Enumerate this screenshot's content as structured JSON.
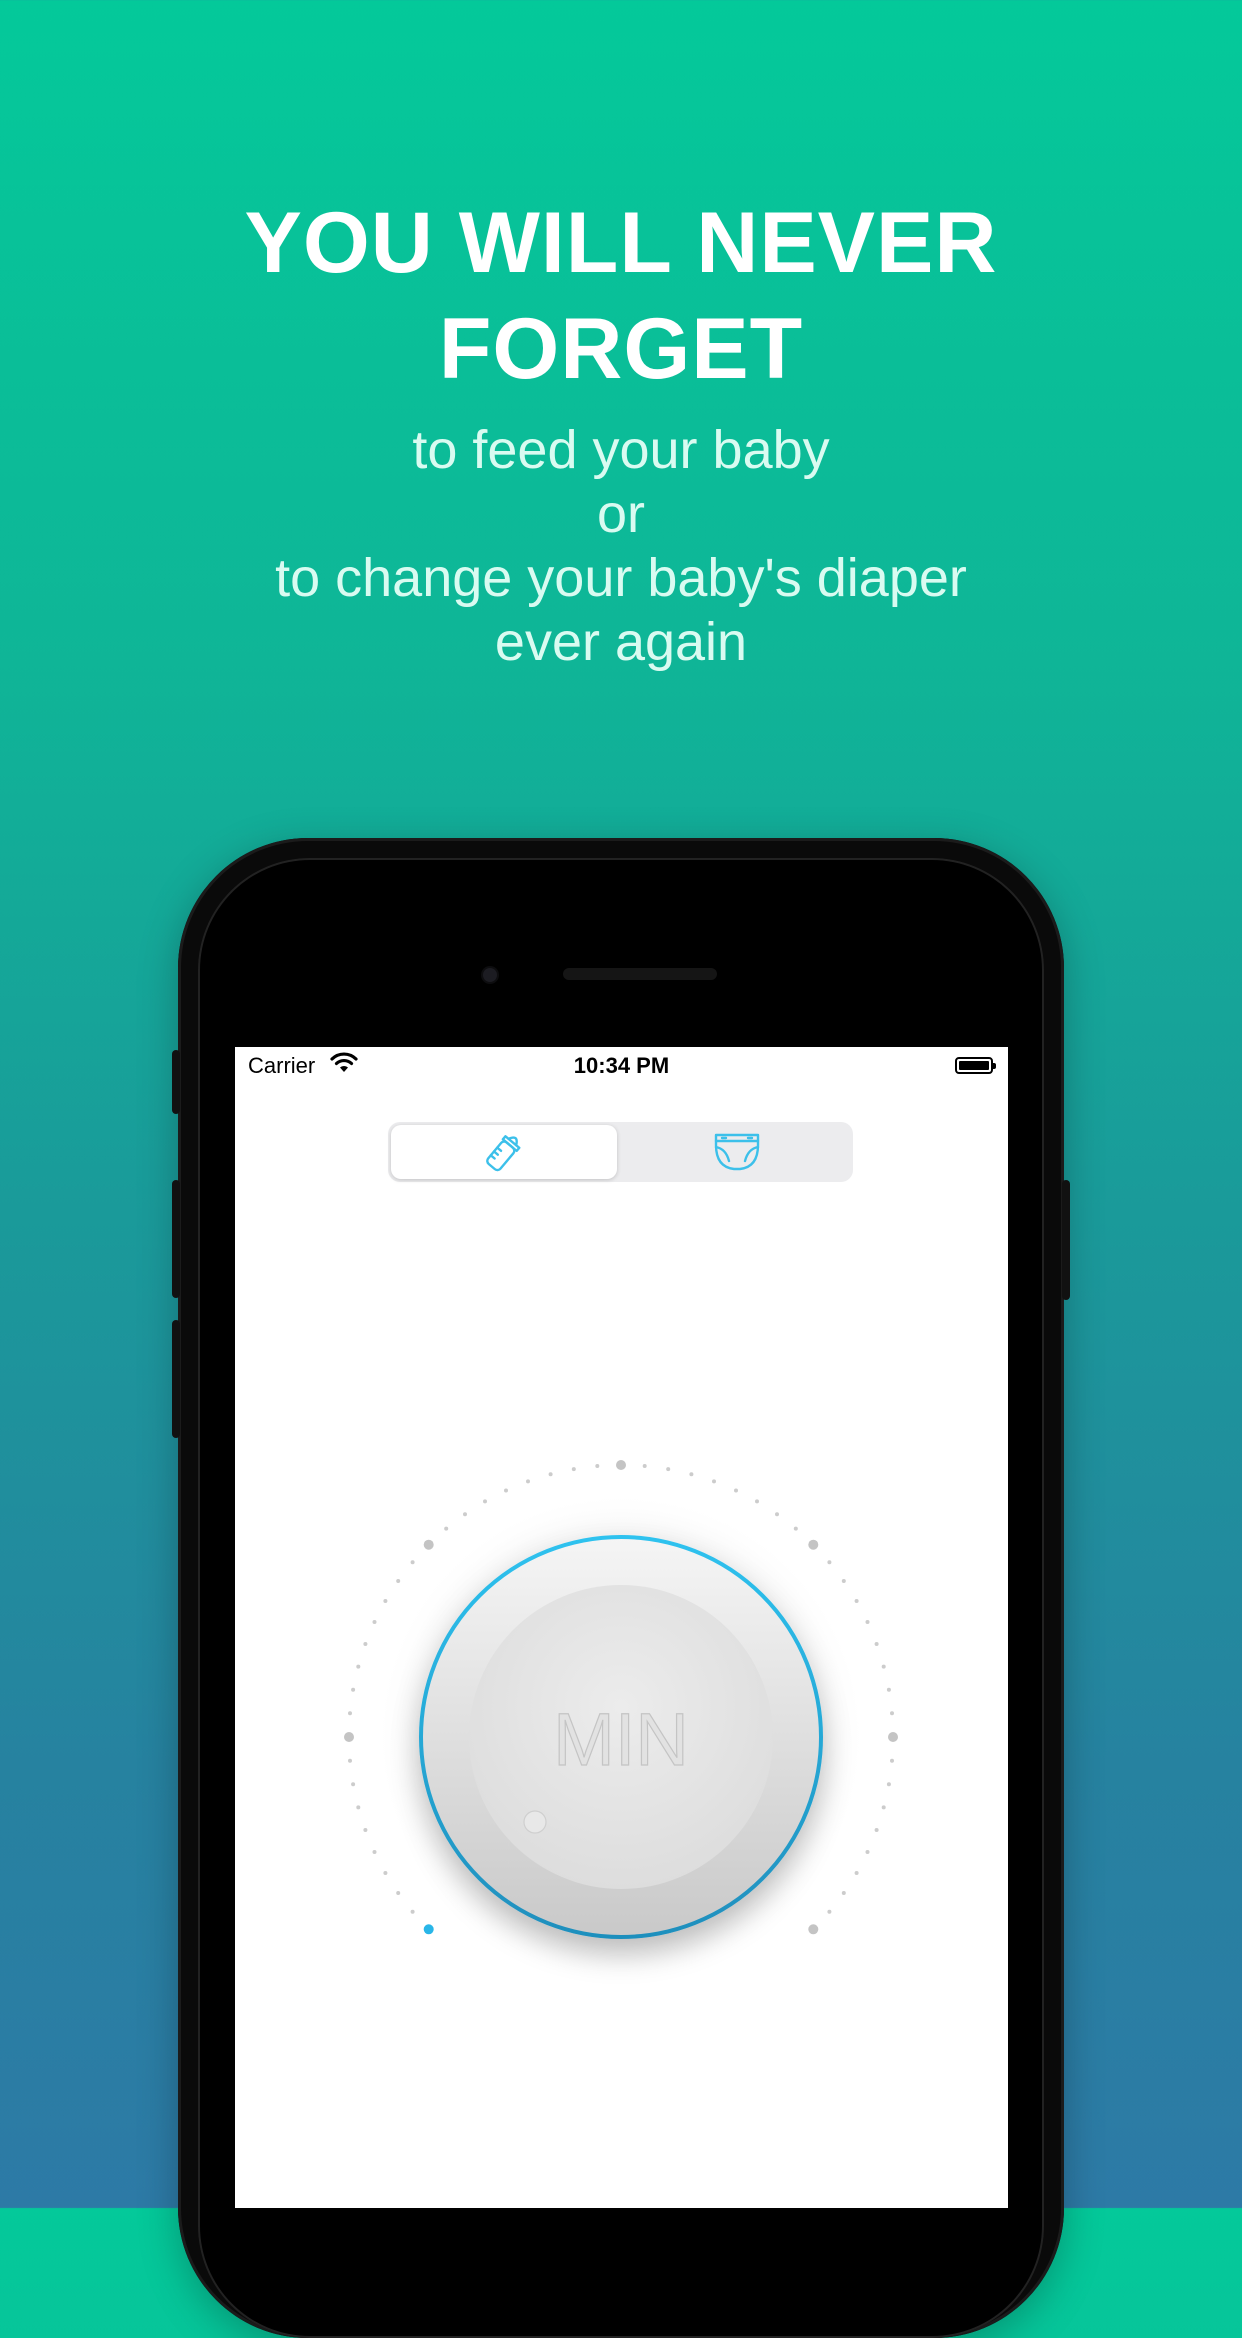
{
  "headline": {
    "line1": "YOU WILL NEVER",
    "line2": "FORGET"
  },
  "subtitle": {
    "line1": "to feed your baby",
    "line2": "or",
    "line3": "to change your baby's diaper",
    "line4": "ever again"
  },
  "status_bar": {
    "carrier": "Carrier",
    "time": "10:34 PM"
  },
  "tabs": [
    {
      "icon": "baby-bottle-icon",
      "selected": true
    },
    {
      "icon": "diaper-icon",
      "selected": false
    }
  ],
  "dial": {
    "label": "MIN",
    "ring_color": "#29b6e8",
    "value_fraction": 0
  },
  "colors": {
    "accent": "#29b6e8",
    "bg_top": "#04c99a",
    "bg_bottom": "#2d7aa6"
  }
}
